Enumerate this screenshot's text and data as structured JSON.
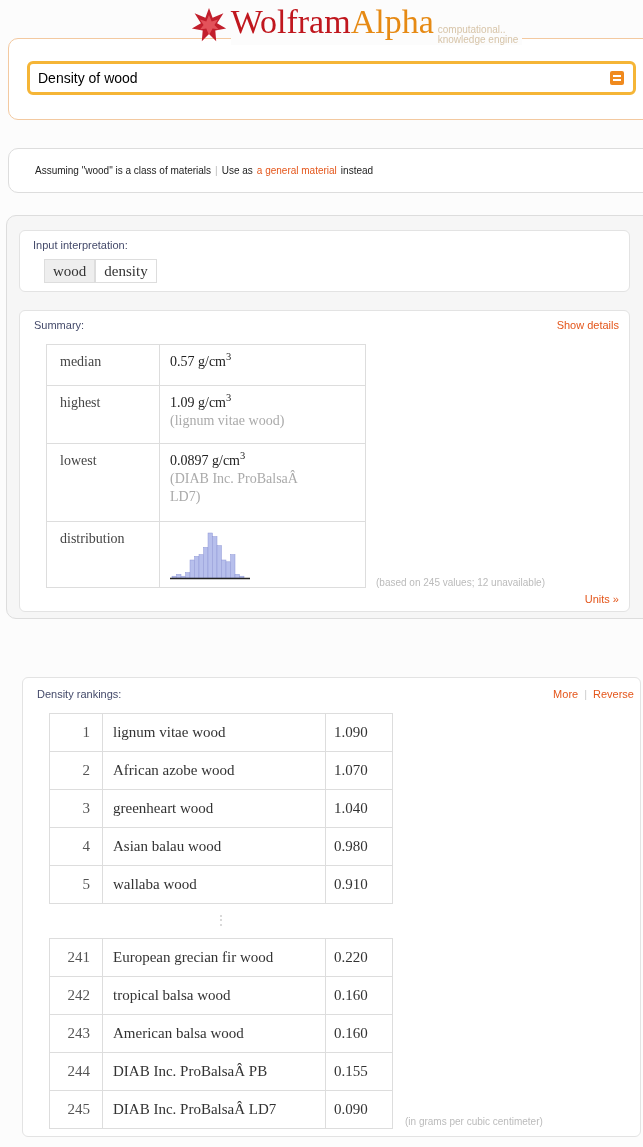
{
  "logo": {
    "word_1": "Wolfram",
    "word_2": "Alpha",
    "tagline_1": "computational..",
    "tagline_2": "knowledge engine"
  },
  "search": {
    "value": "Density of wood"
  },
  "assumption": {
    "text": "Assuming \"wood\" is a class of materials",
    "separator": "|",
    "prefix": "Use as",
    "link": "a general material",
    "suffix": "instead"
  },
  "input_interpretation": {
    "title": "Input interpretation:",
    "terms": [
      {
        "text": "wood",
        "kind": "entity"
      },
      {
        "text": "density",
        "kind": "property"
      }
    ]
  },
  "summary": {
    "title": "Summary:",
    "action": "Show details",
    "rows": [
      {
        "label": "median",
        "value": "0.57 g/cm$^{3}$"
      },
      {
        "label": "highest",
        "value": "1.09 g/cm$^{3}$",
        "note": "(lignum vitae wood)"
      },
      {
        "label": "lowest",
        "value": "0.0897 g/cm$^{3}$",
        "note": "(DIAB Inc. ProBalsaÂ LD7)"
      },
      {
        "label": "distribution",
        "kind": "histogram"
      }
    ],
    "footnote": "(based on 245 values; 12 unavailable)",
    "units_link": "Units »"
  },
  "rankings": {
    "title": "Density rankings:",
    "actions": [
      "More",
      "Reverse"
    ],
    "separator": "|",
    "top": [
      {
        "rank": "1",
        "name": "lignum vitae wood",
        "value": "1.090"
      },
      {
        "rank": "2",
        "name": "African azobe wood",
        "value": "1.070"
      },
      {
        "rank": "3",
        "name": "greenheart wood",
        "value": "1.040"
      },
      {
        "rank": "4",
        "name": "Asian balau wood",
        "value": "0.980"
      },
      {
        "rank": "5",
        "name": "wallaba wood",
        "value": "0.910"
      }
    ],
    "ellipsis": "⋮",
    "bottom": [
      {
        "rank": "241",
        "name": "European grecian fir wood",
        "value": "0.220"
      },
      {
        "rank": "242",
        "name": "tropical balsa wood",
        "value": "0.160"
      },
      {
        "rank": "243",
        "name": "American balsa wood",
        "value": "0.160"
      },
      {
        "rank": "244",
        "name": "DIAB Inc. ProBalsaÂ PB",
        "value": "0.155"
      },
      {
        "rank": "245",
        "name": "DIAB Inc. ProBalsaÂ LD7",
        "value": "0.090"
      }
    ],
    "footnote": "(in grams per cubic centimeter)"
  }
}
